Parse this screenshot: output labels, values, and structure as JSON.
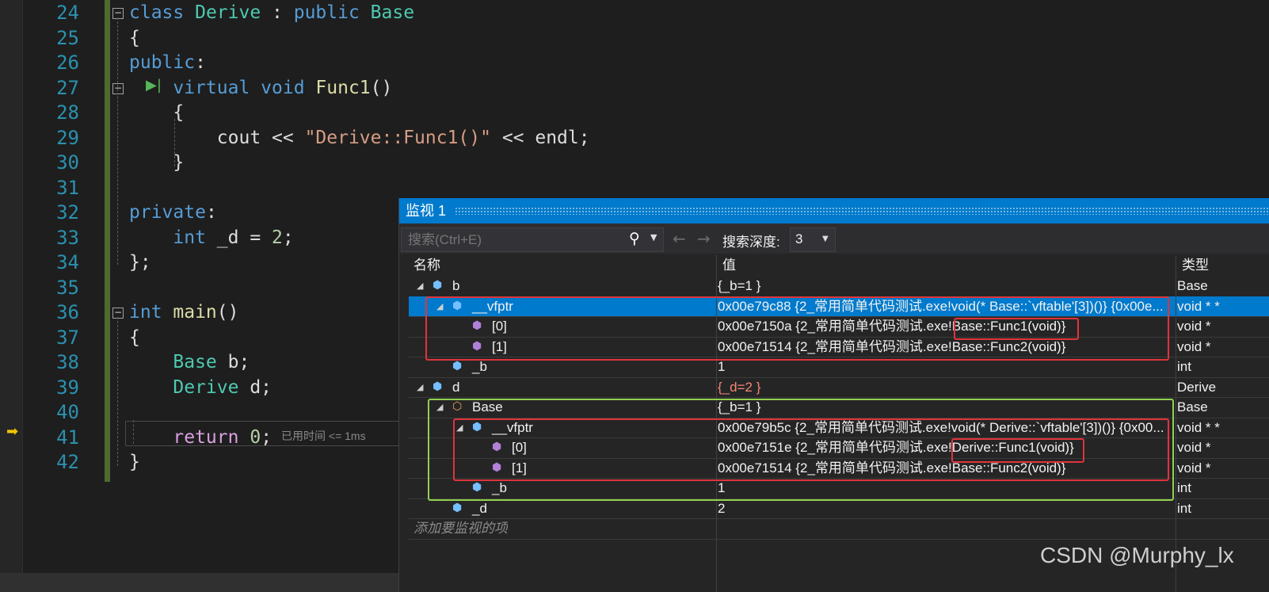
{
  "editor": {
    "lines": [
      {
        "n": "24",
        "html_parts": [
          [
            "kw",
            "class "
          ],
          [
            "ty",
            "Derive"
          ],
          [
            "",
            " : "
          ],
          [
            "kw",
            "public "
          ],
          [
            "ty",
            "Base"
          ]
        ],
        "fold": "⊟"
      },
      {
        "n": "25",
        "html_parts": [
          [
            "",
            "{"
          ]
        ]
      },
      {
        "n": "26",
        "html_parts": [
          [
            "kw",
            "public"
          ],
          [
            "",
            ":"
          ]
        ]
      },
      {
        "n": "27",
        "html_parts": [
          [
            "",
            "    "
          ],
          [
            "kw",
            "virtual "
          ],
          [
            "kw",
            "void "
          ],
          [
            "fn",
            "Func1"
          ],
          [
            "",
            "()"
          ]
        ],
        "fold": "⊟"
      },
      {
        "n": "28",
        "html_parts": [
          [
            "",
            "    {"
          ]
        ]
      },
      {
        "n": "29",
        "html_parts": [
          [
            "",
            "        cout << "
          ],
          [
            "str",
            "\"Derive::Func1()\""
          ],
          [
            "",
            " << endl;"
          ]
        ]
      },
      {
        "n": "30",
        "html_parts": [
          [
            "",
            "    }"
          ]
        ]
      },
      {
        "n": "31",
        "html_parts": [
          [
            "",
            ""
          ]
        ]
      },
      {
        "n": "32",
        "html_parts": [
          [
            "kw",
            "private"
          ],
          [
            "",
            ":"
          ]
        ]
      },
      {
        "n": "33",
        "html_parts": [
          [
            "",
            "    "
          ],
          [
            "kw",
            "int"
          ],
          [
            "",
            " _d = "
          ],
          [
            "num",
            "2"
          ],
          [
            "",
            ";"
          ]
        ]
      },
      {
        "n": "34",
        "html_parts": [
          [
            "",
            "};"
          ]
        ]
      },
      {
        "n": "35",
        "html_parts": [
          [
            "",
            ""
          ]
        ]
      },
      {
        "n": "36",
        "html_parts": [
          [
            "kw",
            "int "
          ],
          [
            "fn",
            "main"
          ],
          [
            "",
            "()"
          ]
        ],
        "fold": "⊟"
      },
      {
        "n": "37",
        "html_parts": [
          [
            "",
            "{"
          ]
        ]
      },
      {
        "n": "38",
        "html_parts": [
          [
            "",
            "    "
          ],
          [
            "ty",
            "Base"
          ],
          [
            "",
            " b;"
          ]
        ]
      },
      {
        "n": "39",
        "html_parts": [
          [
            "",
            "    "
          ],
          [
            "ty",
            "Derive"
          ],
          [
            "",
            " d;"
          ]
        ]
      },
      {
        "n": "40",
        "html_parts": [
          [
            "",
            ""
          ]
        ]
      },
      {
        "n": "41",
        "html_parts": [
          [
            "",
            "    "
          ],
          [
            "rk",
            "return "
          ],
          [
            "num",
            "0"
          ],
          [
            "",
            ";"
          ]
        ]
      },
      {
        "n": "42",
        "html_parts": [
          [
            "",
            "}"
          ]
        ]
      }
    ],
    "elapsed_text": "已用时间 <= 1ms",
    "execution_arrow": "➡",
    "status_text": ""
  },
  "watch": {
    "title": "监视 1",
    "search_placeholder": "搜索(Ctrl+E)",
    "search_depth_label": "搜索深度:",
    "search_depth_value": "3",
    "back_arrow": "←",
    "forward_arrow": "→",
    "columns": {
      "name": "名称",
      "value": "值",
      "type": "类型"
    },
    "rows": [
      {
        "indent": 0,
        "expander": "◢",
        "icon": "cube",
        "icon_color": "blue",
        "name": "b",
        "value": "{_b=1 }",
        "type": "Base"
      },
      {
        "indent": 1,
        "expander": "◢",
        "icon": "cube",
        "icon_color": "blue",
        "name": "__vfptr",
        "value": "0x00e79c88 {2_常用简单代码测试.exe!void(* Base::`vftable'[3])()} {0x00e...",
        "type": "void * *",
        "selected": true
      },
      {
        "indent": 2,
        "expander": "",
        "icon": "cube",
        "icon_color": "purple",
        "name": "[0]",
        "value": "0x00e7150a {2_常用简单代码测试.exe!Base::Func1(void)}",
        "type": "void *"
      },
      {
        "indent": 2,
        "expander": "",
        "icon": "cube",
        "icon_color": "purple",
        "name": "[1]",
        "value": "0x00e71514 {2_常用简单代码测试.exe!Base::Func2(void)}",
        "type": "void *"
      },
      {
        "indent": 1,
        "expander": "",
        "icon": "cube-lock",
        "icon_color": "blue",
        "name": "_b",
        "value": "1",
        "type": "int"
      },
      {
        "indent": 0,
        "expander": "◢",
        "icon": "cube",
        "icon_color": "blue",
        "name": "d",
        "value": "{_d=2 }",
        "type": "Derive",
        "value_red": true
      },
      {
        "indent": 1,
        "expander": "◢",
        "icon": "base-class",
        "icon_color": "orange",
        "name": "Base",
        "value": "{_b=1 }",
        "type": "Base"
      },
      {
        "indent": 2,
        "expander": "◢",
        "icon": "cube",
        "icon_color": "blue",
        "name": "__vfptr",
        "value": "0x00e79b5c {2_常用简单代码测试.exe!void(* Derive::`vftable'[3])()} {0x00...",
        "type": "void * *"
      },
      {
        "indent": 3,
        "expander": "",
        "icon": "cube",
        "icon_color": "purple",
        "name": "[0]",
        "value": "0x00e7151e {2_常用简单代码测试.exe!Derive::Func1(void)}",
        "type": "void *"
      },
      {
        "indent": 3,
        "expander": "",
        "icon": "cube",
        "icon_color": "purple",
        "name": "[1]",
        "value": "0x00e71514 {2_常用简单代码测试.exe!Base::Func2(void)}",
        "type": "void *"
      },
      {
        "indent": 2,
        "expander": "",
        "icon": "cube-lock",
        "icon_color": "blue",
        "name": "_b",
        "value": "1",
        "type": "int"
      },
      {
        "indent": 1,
        "expander": "",
        "icon": "cube-lock",
        "icon_color": "blue",
        "name": "_d",
        "value": "2",
        "type": "int"
      }
    ],
    "add_item_placeholder": "添加要监视的项"
  },
  "watermark": "CSDN @Murphy_lx"
}
